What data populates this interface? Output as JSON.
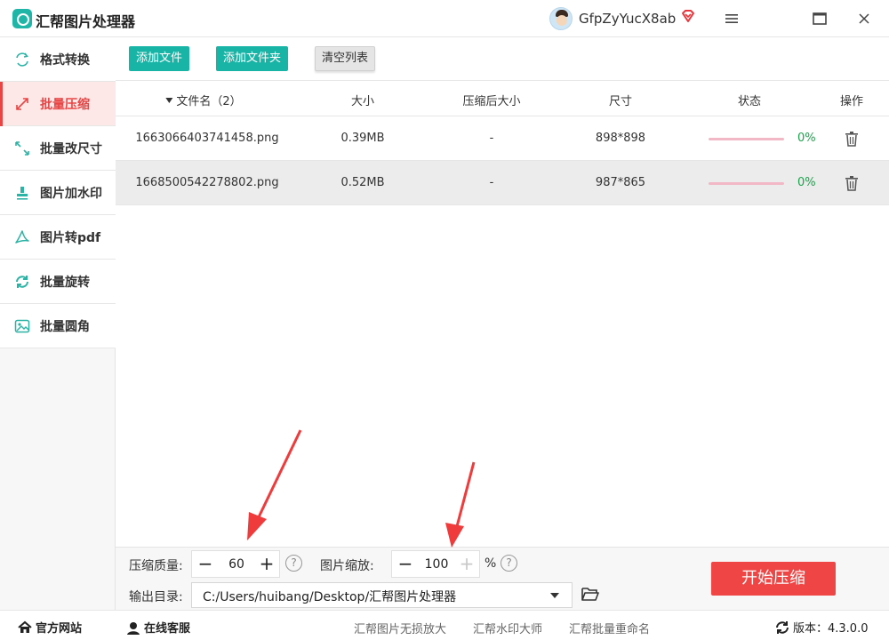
{
  "window": {
    "title": "汇帮图片处理器",
    "username": "GfpZyYucX8ab"
  },
  "sidebar": {
    "items": [
      {
        "label": "格式转换"
      },
      {
        "label": "批量压缩"
      },
      {
        "label": "批量改尺寸"
      },
      {
        "label": "图片加水印"
      },
      {
        "label": "图片转pdf"
      },
      {
        "label": "批量旋转"
      },
      {
        "label": "批量圆角"
      }
    ],
    "active_index": 1
  },
  "toolbar": {
    "add_file": "添加文件",
    "add_folder": "添加文件夹",
    "clear_list": "清空列表"
  },
  "table": {
    "columns": {
      "name": "文件名（2）",
      "size": "大小",
      "compressed_size": "压缩后大小",
      "dimensions": "尺寸",
      "status": "状态",
      "actions": "操作"
    },
    "rows": [
      {
        "name": "1663066403741458.png",
        "size": "0.39MB",
        "compressed": "-",
        "dimensions": "898*898",
        "percent": "0%"
      },
      {
        "name": "1668500542278802.png",
        "size": "0.52MB",
        "compressed": "-",
        "dimensions": "987*865",
        "percent": "0%"
      }
    ]
  },
  "settings": {
    "quality_label": "压缩质量:",
    "quality_value": "60",
    "scale_label": "图片缩放:",
    "scale_value": "100",
    "scale_unit": "%",
    "minus": "−",
    "plus": "+",
    "help": "?",
    "output_label": "输出目录:",
    "output_dir": "C:/Users/huibang/Desktop/汇帮图片处理器",
    "start_button": "开始压缩"
  },
  "footer": {
    "website": "官方网站",
    "support": "在线客服",
    "links": [
      "汇帮图片无损放大",
      "汇帮水印大师",
      "汇帮批量重命名"
    ],
    "version": "版本：4.3.0.0"
  },
  "colors": {
    "accent_red": "#f04545",
    "teal": "#18b5a6",
    "status_green": "#1aa34a",
    "progress_pink": "#f2b8c6",
    "annotation_red": "#ef3b3b"
  }
}
